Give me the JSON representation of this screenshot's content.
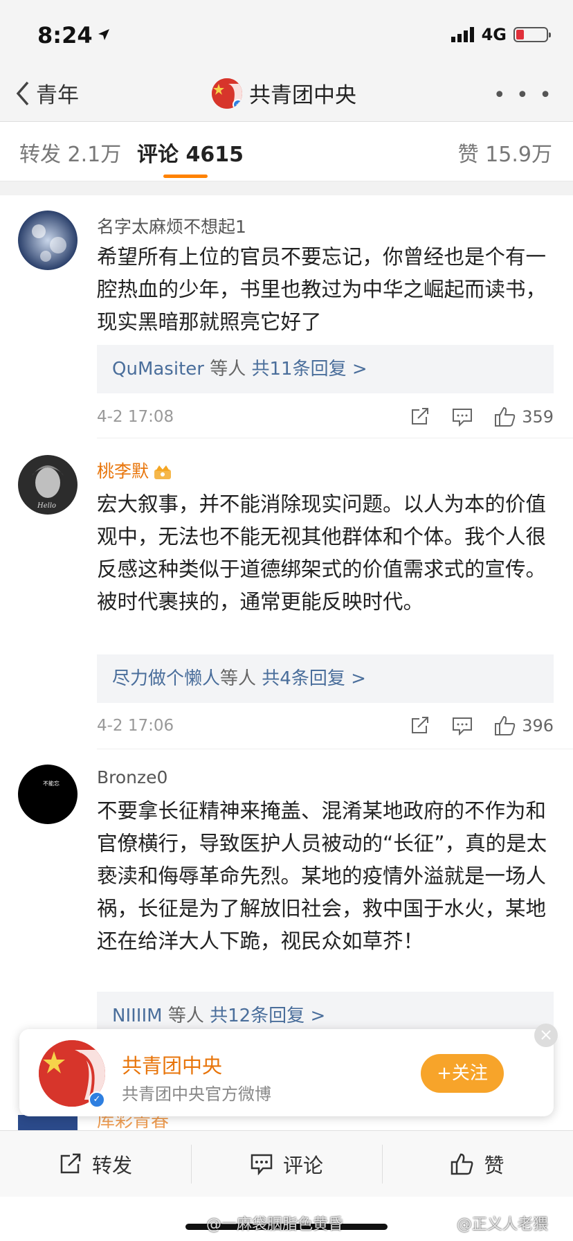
{
  "status": {
    "time": "8:24",
    "network": "4G",
    "battery_level": 0.25
  },
  "nav": {
    "back_label": "青年",
    "title": "共青团中央"
  },
  "tabs": {
    "repost": "转发 2.1万",
    "comment": "评论 4615",
    "like": "赞 15.9万"
  },
  "comments": [
    {
      "name": "名字太麻烦不想起1",
      "text": "希望所有上位的官员不要忘记，你曾经也是个有一腔热血的少年，书里也教过为中华之崛起而读书，现实黑暗那就照亮它好了",
      "reply_user": "QuMasiter",
      "reply_mid": " 等人 ",
      "reply_count": "共11条回复 >",
      "date": "4-2 17:08",
      "likes": "359"
    },
    {
      "name": "桃李默",
      "text": "宏大叙事，并不能消除现实问题。以人为本的价值观中，无法也不能无视其他群体和个体。我个人很反感这种类似于道德绑架式的价值需求式的宣传。被时代裹挟的，通常更能反映时代。",
      "reply_user": "尽力做个懒人",
      "reply_mid": "等人 ",
      "reply_count": "共4条回复 >",
      "date": "4-2 17:06",
      "likes": "396"
    },
    {
      "name": "Bronze0",
      "text": "不要拿长征精神来掩盖、混淆某地政府的不作为和官僚横行，导致医护人员被动的“长征”，真的是太亵渎和侮辱革命先烈。某地的疫情外溢就是一场人祸，长征是为了解放旧社会，救中国于水火，某地还在给洋大人下跪，视民众如草芥！",
      "reply_user": "NIIIIM",
      "reply_mid": " 等人 ",
      "reply_count": "共12条回复 >"
    }
  ],
  "popup": {
    "name": "共青团中央",
    "subtitle": "共青团中央官方微博",
    "follow": "+关注",
    "close": "×"
  },
  "peek_name": "库彩青春",
  "toolbar": {
    "repost": "转发",
    "comment": "评论",
    "like": "赞"
  },
  "watermarks": {
    "left": "@一麻袋胭脂色黄昏",
    "right": "@正义人老猥"
  },
  "colors": {
    "accent_orange": "#ff8200",
    "link_blue": "#4a6e9b",
    "follow_orange": "#f7a42a"
  }
}
